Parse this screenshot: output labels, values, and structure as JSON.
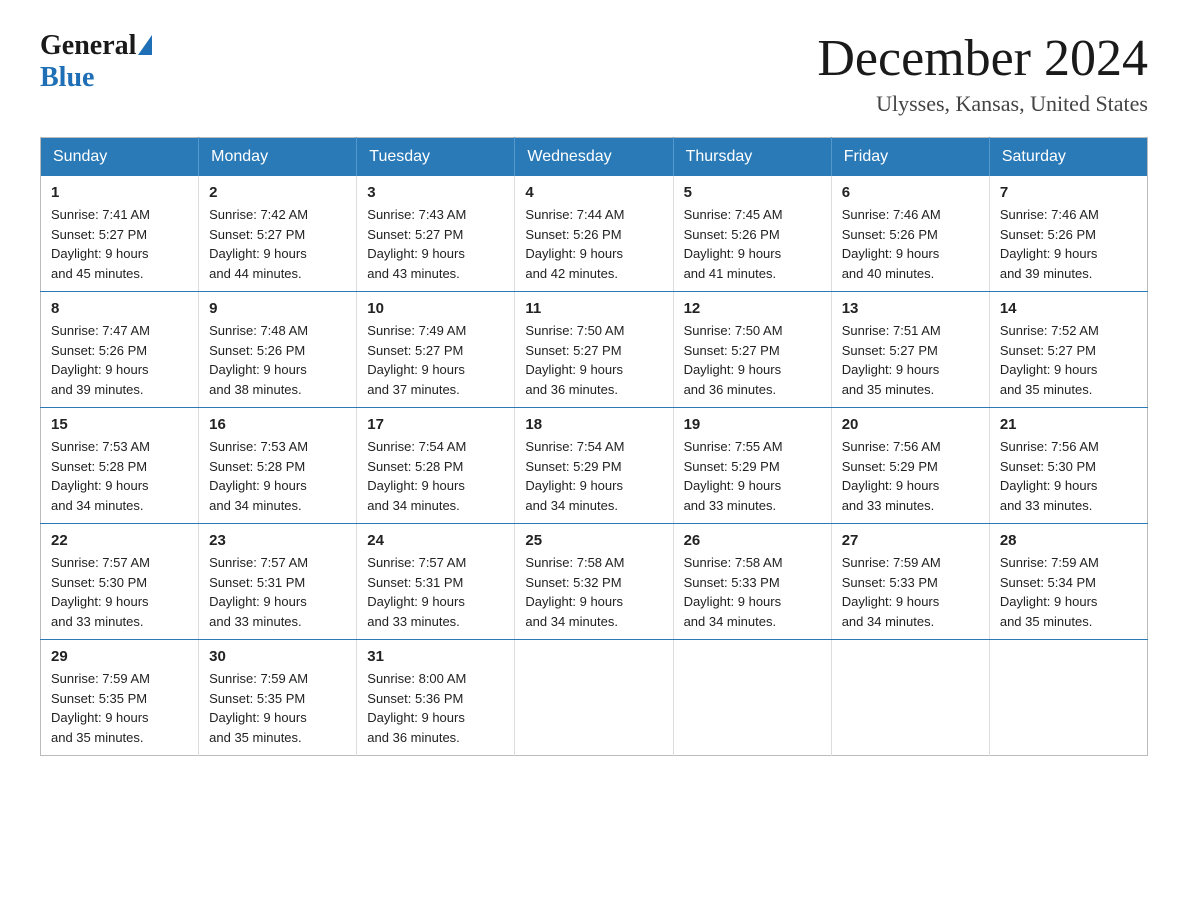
{
  "header": {
    "logo_general": "General",
    "logo_blue": "Blue",
    "month_title": "December 2024",
    "location": "Ulysses, Kansas, United States"
  },
  "days_of_week": [
    "Sunday",
    "Monday",
    "Tuesday",
    "Wednesday",
    "Thursday",
    "Friday",
    "Saturday"
  ],
  "weeks": [
    [
      {
        "day": "1",
        "sunrise": "7:41 AM",
        "sunset": "5:27 PM",
        "daylight": "9 hours and 45 minutes."
      },
      {
        "day": "2",
        "sunrise": "7:42 AM",
        "sunset": "5:27 PM",
        "daylight": "9 hours and 44 minutes."
      },
      {
        "day": "3",
        "sunrise": "7:43 AM",
        "sunset": "5:27 PM",
        "daylight": "9 hours and 43 minutes."
      },
      {
        "day": "4",
        "sunrise": "7:44 AM",
        "sunset": "5:26 PM",
        "daylight": "9 hours and 42 minutes."
      },
      {
        "day": "5",
        "sunrise": "7:45 AM",
        "sunset": "5:26 PM",
        "daylight": "9 hours and 41 minutes."
      },
      {
        "day": "6",
        "sunrise": "7:46 AM",
        "sunset": "5:26 PM",
        "daylight": "9 hours and 40 minutes."
      },
      {
        "day": "7",
        "sunrise": "7:46 AM",
        "sunset": "5:26 PM",
        "daylight": "9 hours and 39 minutes."
      }
    ],
    [
      {
        "day": "8",
        "sunrise": "7:47 AM",
        "sunset": "5:26 PM",
        "daylight": "9 hours and 39 minutes."
      },
      {
        "day": "9",
        "sunrise": "7:48 AM",
        "sunset": "5:26 PM",
        "daylight": "9 hours and 38 minutes."
      },
      {
        "day": "10",
        "sunrise": "7:49 AM",
        "sunset": "5:27 PM",
        "daylight": "9 hours and 37 minutes."
      },
      {
        "day": "11",
        "sunrise": "7:50 AM",
        "sunset": "5:27 PM",
        "daylight": "9 hours and 36 minutes."
      },
      {
        "day": "12",
        "sunrise": "7:50 AM",
        "sunset": "5:27 PM",
        "daylight": "9 hours and 36 minutes."
      },
      {
        "day": "13",
        "sunrise": "7:51 AM",
        "sunset": "5:27 PM",
        "daylight": "9 hours and 35 minutes."
      },
      {
        "day": "14",
        "sunrise": "7:52 AM",
        "sunset": "5:27 PM",
        "daylight": "9 hours and 35 minutes."
      }
    ],
    [
      {
        "day": "15",
        "sunrise": "7:53 AM",
        "sunset": "5:28 PM",
        "daylight": "9 hours and 34 minutes."
      },
      {
        "day": "16",
        "sunrise": "7:53 AM",
        "sunset": "5:28 PM",
        "daylight": "9 hours and 34 minutes."
      },
      {
        "day": "17",
        "sunrise": "7:54 AM",
        "sunset": "5:28 PM",
        "daylight": "9 hours and 34 minutes."
      },
      {
        "day": "18",
        "sunrise": "7:54 AM",
        "sunset": "5:29 PM",
        "daylight": "9 hours and 34 minutes."
      },
      {
        "day": "19",
        "sunrise": "7:55 AM",
        "sunset": "5:29 PM",
        "daylight": "9 hours and 33 minutes."
      },
      {
        "day": "20",
        "sunrise": "7:56 AM",
        "sunset": "5:29 PM",
        "daylight": "9 hours and 33 minutes."
      },
      {
        "day": "21",
        "sunrise": "7:56 AM",
        "sunset": "5:30 PM",
        "daylight": "9 hours and 33 minutes."
      }
    ],
    [
      {
        "day": "22",
        "sunrise": "7:57 AM",
        "sunset": "5:30 PM",
        "daylight": "9 hours and 33 minutes."
      },
      {
        "day": "23",
        "sunrise": "7:57 AM",
        "sunset": "5:31 PM",
        "daylight": "9 hours and 33 minutes."
      },
      {
        "day": "24",
        "sunrise": "7:57 AM",
        "sunset": "5:31 PM",
        "daylight": "9 hours and 33 minutes."
      },
      {
        "day": "25",
        "sunrise": "7:58 AM",
        "sunset": "5:32 PM",
        "daylight": "9 hours and 34 minutes."
      },
      {
        "day": "26",
        "sunrise": "7:58 AM",
        "sunset": "5:33 PM",
        "daylight": "9 hours and 34 minutes."
      },
      {
        "day": "27",
        "sunrise": "7:59 AM",
        "sunset": "5:33 PM",
        "daylight": "9 hours and 34 minutes."
      },
      {
        "day": "28",
        "sunrise": "7:59 AM",
        "sunset": "5:34 PM",
        "daylight": "9 hours and 35 minutes."
      }
    ],
    [
      {
        "day": "29",
        "sunrise": "7:59 AM",
        "sunset": "5:35 PM",
        "daylight": "9 hours and 35 minutes."
      },
      {
        "day": "30",
        "sunrise": "7:59 AM",
        "sunset": "5:35 PM",
        "daylight": "9 hours and 35 minutes."
      },
      {
        "day": "31",
        "sunrise": "8:00 AM",
        "sunset": "5:36 PM",
        "daylight": "9 hours and 36 minutes."
      },
      null,
      null,
      null,
      null
    ]
  ],
  "labels": {
    "sunrise": "Sunrise:",
    "sunset": "Sunset:",
    "daylight": "Daylight:"
  }
}
